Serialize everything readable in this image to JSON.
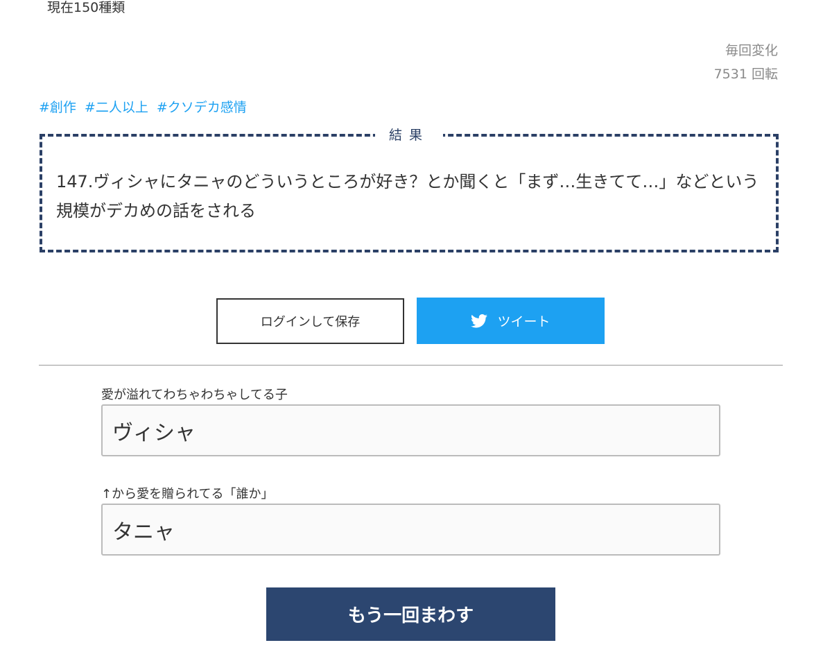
{
  "header": {
    "count_text": "現在150種類"
  },
  "meta": {
    "mode": "毎回変化",
    "spins": "7531 回転"
  },
  "tags": [
    "#創作",
    "#二人以上",
    "#クソデカ感情"
  ],
  "result": {
    "label": "結果",
    "text": "147.ヴィシャにタニャのどういうところが好き？とか聞くと「まず…生きてて…」などという規模がデカめの話をされる"
  },
  "actions": {
    "login_save": "ログインして保存",
    "tweet": "ツイート"
  },
  "form": {
    "field1": {
      "label": "愛が溢れてわちゃわちゃしてる子",
      "value": "ヴィシャ"
    },
    "field2": {
      "label": "↑から愛を贈られてる「誰か」",
      "value": "タニャ"
    }
  },
  "spin_again": "もう一回まわす",
  "icons": {
    "tweet": "twitter-bird-icon"
  },
  "colors": {
    "accent": "#1da1f2",
    "primary": "#2c4670",
    "border": "#2b4066"
  }
}
